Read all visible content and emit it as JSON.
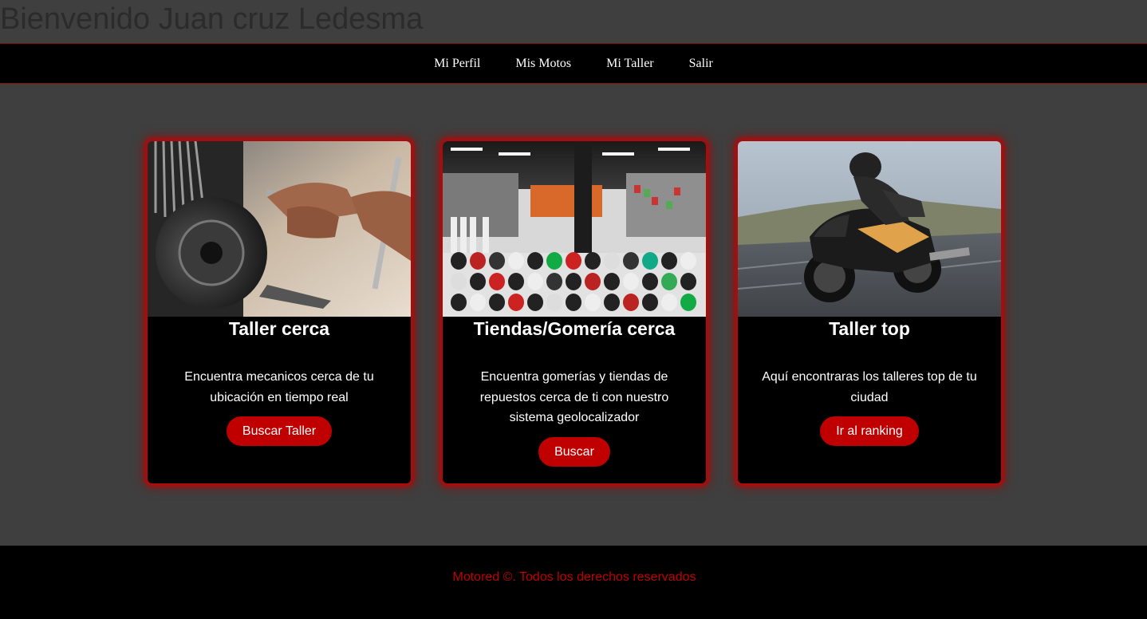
{
  "header": {
    "welcome": "Bienvenido Juan cruz Ledesma"
  },
  "nav": {
    "items": [
      {
        "label": "Mi Perfil"
      },
      {
        "label": "Mis Motos"
      },
      {
        "label": "Mi Taller"
      },
      {
        "label": "Salir"
      }
    ]
  },
  "cards": [
    {
      "image": "mechanic-repairing-motorcycle-photo",
      "title": "Taller cerca",
      "text": "Encuentra mecanicos cerca de tu ubicación en tiempo real",
      "button": "Buscar Taller"
    },
    {
      "image": "helmet-store-interior-photo",
      "title": "Tiendas/Gomería cerca",
      "text": "Encuentra gomerías y tiendas de repuestos cerca de ti con nuestro sistema geolocalizador",
      "button": "Buscar"
    },
    {
      "image": "rider-on-sport-motorcycle-photo",
      "title": "Taller top",
      "text": "Aquí encontraras los talleres top de tu ciudad",
      "button": "Ir al ranking"
    }
  ],
  "footer": {
    "text": "Motored ©. Todos los derechos reservados"
  },
  "colors": {
    "accent": "#c00000",
    "page_bg": "#3f3f3f",
    "nav_bg": "#000000"
  }
}
